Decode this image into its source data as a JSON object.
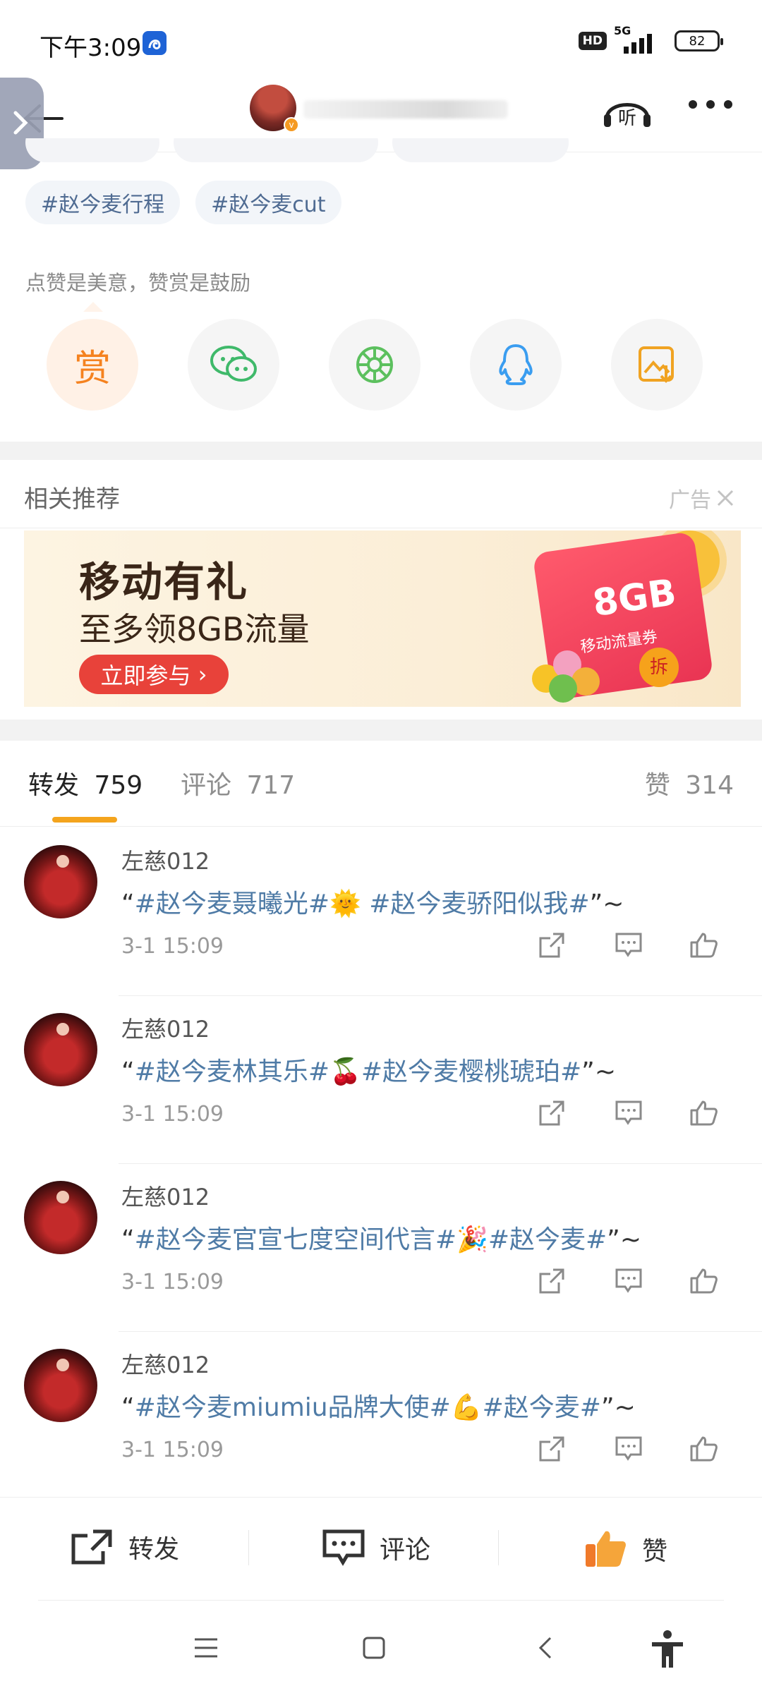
{
  "status_bar": {
    "time": "下午3:09",
    "hd_label": "HD",
    "network_label": "5G",
    "battery": "82"
  },
  "header": {
    "back_icon": "arrow-left-icon",
    "side_tab_icon": "chevron-right-icon",
    "listen_icon": "headphones-icon",
    "listen_label": "听",
    "more_icon": "more-dots-icon"
  },
  "tags": [
    "#赵今麦行程",
    "#赵今麦cut"
  ],
  "praise": {
    "text": "点赞是美意，赞赏是鼓励",
    "reward_label": "赏",
    "share_icons": [
      "reward-icon",
      "wechat-icon",
      "moments-icon",
      "qq-icon",
      "save-image-icon"
    ]
  },
  "recommend": {
    "title": "相关推荐",
    "ad_label": "广告",
    "banner": {
      "headline": "移动有礼",
      "subline": "至多领8GB流量",
      "button": "立即参与",
      "card_text": "8GB",
      "card_sub": "移动流量券",
      "badge": "拆"
    }
  },
  "tabs": [
    {
      "label": "转发",
      "count": "759"
    },
    {
      "label": "评论",
      "count": "717"
    },
    {
      "label": "赞",
      "count": "314"
    }
  ],
  "reposts": [
    {
      "user": "左慈012",
      "open": "“",
      "t1": "#赵今麦聂曦光#",
      "emoji": "🌞",
      "mid": " ",
      "t2": "#赵今麦骄阳似我#",
      "close": "”~",
      "time": "3-1 15:09"
    },
    {
      "user": "左慈012",
      "open": "“",
      "t1": "#赵今麦林其乐#",
      "emoji": "🍒",
      "mid": "",
      "t2": "#赵今麦樱桃琥珀#",
      "close": "”~",
      "time": "3-1 15:09"
    },
    {
      "user": "左慈012",
      "open": "“",
      "t1": "#赵今麦官宣七度空间代言#",
      "emoji": "🎉",
      "mid": "",
      "t2": "#赵今麦#",
      "close": "”~",
      "time": "3-1 15:09"
    },
    {
      "user": "左慈012",
      "open": "“",
      "t1": "#赵今麦miumiu品牌大使#",
      "emoji": "💪",
      "mid": "",
      "t2": "#赵今麦#",
      "close": "”~",
      "time": "3-1 15:09"
    }
  ],
  "bottom_bar": {
    "repost": "转发",
    "comment": "评论",
    "like": "赞"
  },
  "colors": {
    "accent": "#f4a41d",
    "topic_link": "#4f7ba6",
    "reward": "#f5821f"
  }
}
